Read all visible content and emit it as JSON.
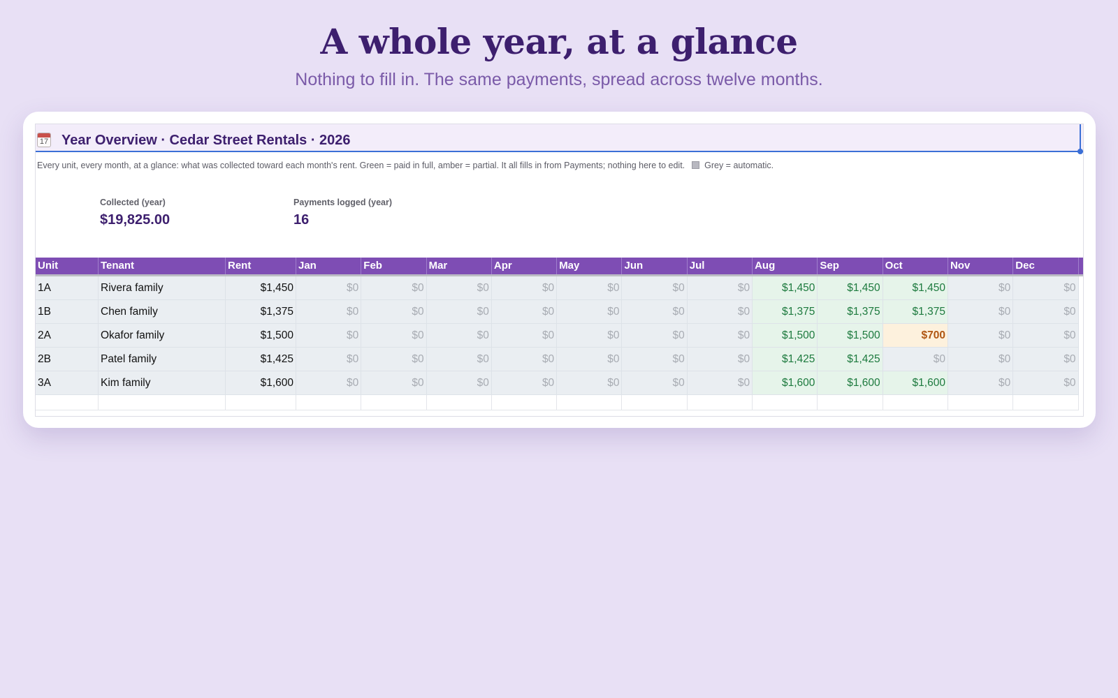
{
  "hero": {
    "title": "A whole year, at a glance",
    "subtitle": "Nothing to fill in. The same payments, spread across twelve months."
  },
  "sheet": {
    "icon": "calendar-icon",
    "icon_day": "17",
    "title": "Year Overview  ·  Cedar Street Rentals  ·  2026",
    "description": "Every unit, every month, at a glance: what was collected toward each month's rent. Green = paid in full, amber = partial. It all fills in from Payments; nothing here to edit.",
    "legend_grey": "Grey = automatic."
  },
  "kpis": {
    "collected_label": "Collected (year)",
    "collected_value": "$19,825.00",
    "payments_label": "Payments logged (year)",
    "payments_value": "16"
  },
  "table": {
    "columns": [
      "Unit",
      "Tenant",
      "Rent",
      "Jan",
      "Feb",
      "Mar",
      "Apr",
      "May",
      "Jun",
      "Jul",
      "Aug",
      "Sep",
      "Oct",
      "Nov",
      "Dec"
    ],
    "rows": [
      {
        "unit": "1A",
        "tenant": "Rivera family",
        "rent": "$1,450",
        "months": [
          "$0",
          "$0",
          "$0",
          "$0",
          "$0",
          "$0",
          "$0",
          "$1,450",
          "$1,450",
          "$1,450",
          "$0",
          "$0"
        ],
        "status": [
          "none",
          "none",
          "none",
          "none",
          "none",
          "none",
          "none",
          "paid",
          "paid",
          "paid",
          "none",
          "none"
        ]
      },
      {
        "unit": "1B",
        "tenant": "Chen family",
        "rent": "$1,375",
        "months": [
          "$0",
          "$0",
          "$0",
          "$0",
          "$0",
          "$0",
          "$0",
          "$1,375",
          "$1,375",
          "$1,375",
          "$0",
          "$0"
        ],
        "status": [
          "none",
          "none",
          "none",
          "none",
          "none",
          "none",
          "none",
          "paid",
          "paid",
          "paid",
          "none",
          "none"
        ]
      },
      {
        "unit": "2A",
        "tenant": "Okafor family",
        "rent": "$1,500",
        "months": [
          "$0",
          "$0",
          "$0",
          "$0",
          "$0",
          "$0",
          "$0",
          "$1,500",
          "$1,500",
          "$700",
          "$0",
          "$0"
        ],
        "status": [
          "none",
          "none",
          "none",
          "none",
          "none",
          "none",
          "none",
          "paid",
          "paid",
          "partial",
          "none",
          "none"
        ]
      },
      {
        "unit": "2B",
        "tenant": "Patel family",
        "rent": "$1,425",
        "months": [
          "$0",
          "$0",
          "$0",
          "$0",
          "$0",
          "$0",
          "$0",
          "$1,425",
          "$1,425",
          "$0",
          "$0",
          "$0"
        ],
        "status": [
          "none",
          "none",
          "none",
          "none",
          "none",
          "none",
          "none",
          "paid",
          "paid",
          "none",
          "none",
          "none"
        ]
      },
      {
        "unit": "3A",
        "tenant": "Kim family",
        "rent": "$1,600",
        "months": [
          "$0",
          "$0",
          "$0",
          "$0",
          "$0",
          "$0",
          "$0",
          "$1,600",
          "$1,600",
          "$1,600",
          "$0",
          "$0"
        ],
        "status": [
          "none",
          "none",
          "none",
          "none",
          "none",
          "none",
          "none",
          "paid",
          "paid",
          "paid",
          "none",
          "none"
        ]
      }
    ]
  },
  "colors": {
    "background": "#e8e0f5",
    "header_purple": "#7e4db4",
    "title_purple": "#3d1f6e",
    "paid_fill": "#e6f4ea",
    "paid_text": "#1d7a3e",
    "partial_fill": "#fdf1dd",
    "partial_text": "#b05612",
    "selection_blue": "#3b6fd6"
  }
}
